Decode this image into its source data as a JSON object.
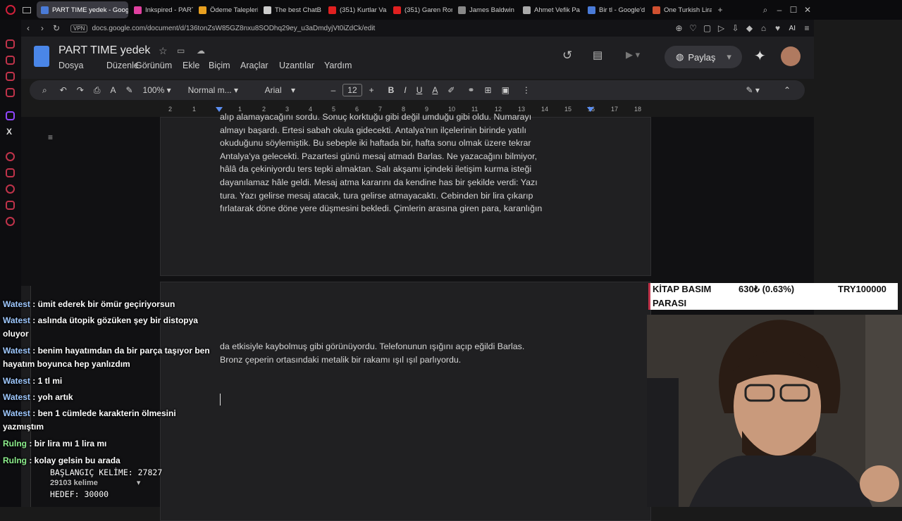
{
  "tabs": [
    {
      "label": "PART TIME yedek - Google",
      "active": true,
      "color": "#4a7bd8"
    },
    {
      "label": "Inkspired - PART",
      "color": "#e040a0"
    },
    {
      "label": "Ödeme Talepleri",
      "color": "#e8a020"
    },
    {
      "label": "The best ChatB",
      "color": "#cccccc"
    },
    {
      "label": "(351) Kurtlar Va",
      "color": "#e02020"
    },
    {
      "label": "(351) Garen Ron",
      "color": "#e02020"
    },
    {
      "label": "James Baldwin",
      "color": "#888888"
    },
    {
      "label": "Ahmet Vefik Pa",
      "color": "#aaaaaa"
    },
    {
      "label": "Bir tl - Google'd",
      "color": "#4a7bd8"
    },
    {
      "label": "One Turkish Lira",
      "color": "#d05030"
    }
  ],
  "address": {
    "vpn": "VPN",
    "url": "docs.google.com/document/d/136tonZsW85GZ8nxu8SODhq29ey_u3aDmdyjVt0iZdCk/edit",
    "ai": "AI"
  },
  "doc": {
    "title": "PART TIME  yedek",
    "menus": [
      "Dosya",
      "Düzenle",
      "Görünüm",
      "Ekle",
      "Biçim",
      "Araçlar",
      "Uzantılar",
      "Yardım"
    ],
    "share_label": "Paylaş",
    "zoom": "100%",
    "style": "Normal m...",
    "font": "Arial",
    "font_size": "12",
    "ruler": [
      "2",
      "1",
      "1",
      "2",
      "3",
      "4",
      "5",
      "6",
      "7",
      "8",
      "9",
      "10",
      "11",
      "12",
      "13",
      "14",
      "15",
      "16",
      "17",
      "18"
    ],
    "page1_lines": [
      "alıp alamayacağını sordu. Sonuç korktuğu gibi değil umduğu gibi oldu. Numarayı",
      "almayı başardı. Ertesi sabah okula gidecekti. Antalya'nın ilçelerinin birinde yatılı",
      "okuduğunu söylemiştik. Bu sebeple iki haftada bir, hafta sonu olmak üzere tekrar",
      "Antalya'ya gelecekti.  Pazartesi günü mesaj atmadı Barlas. Ne yazacağını bilmiyor,",
      "hâlâ da çekiniyordu ters tepki almaktan. Salı akşamı içindeki iletişim kurma isteği",
      "dayanılamaz hâle geldi. Mesaj atma kararını da kendine has bir şekilde verdi: Yazı",
      "tura. Yazı gelirse mesaj atacak, tura gelirse atmayacaktı. Cebinden bir lira çıkarıp",
      "fırlatarak döne döne yere düşmesini bekledi. Çimlerin arasına giren para, karanlığın"
    ],
    "page2_lines": [
      "da etkisiyle kaybolmuş gibi görünüyordu. Telefonunun ışığını açıp eğildi Barlas.",
      "Bronz çeperin ortasındaki metalik bir rakamı ışıl ışıl parlıyordu."
    ],
    "word_count": "29103 kelime"
  },
  "chat": [
    {
      "user": "Watest",
      "text": "ümit ederek bir ömür geçiriyorsun"
    },
    {
      "user": "Watest",
      "text": "aslında ütopik gözüken şey bir distopya oluyor"
    },
    {
      "user": "Watest",
      "text": "benim hayatımdan da bir parça taşıyor ben hayatım boyunca hep yanlızdım"
    },
    {
      "user": "Watest",
      "text": "1 tl mi"
    },
    {
      "user": "Watest",
      "text": "yoh artık"
    },
    {
      "user": "Watest",
      "text": "ben 1 cümlede karakterin ölmesini yazmıştım"
    },
    {
      "user": "Rulng",
      "text": "bir lira mı 1 lira mı"
    },
    {
      "user": "Rulng",
      "text": "kolay gelsin bu arada"
    }
  ],
  "overlay": {
    "start": "BAŞLANGIÇ KELİME: 27827",
    "goal": "HEDEF: 30000"
  },
  "ticker": {
    "label1": "KİTAP BASIM",
    "label2": "PARASI",
    "value": "630₺ (0.63%)",
    "target": "TRY100000"
  }
}
